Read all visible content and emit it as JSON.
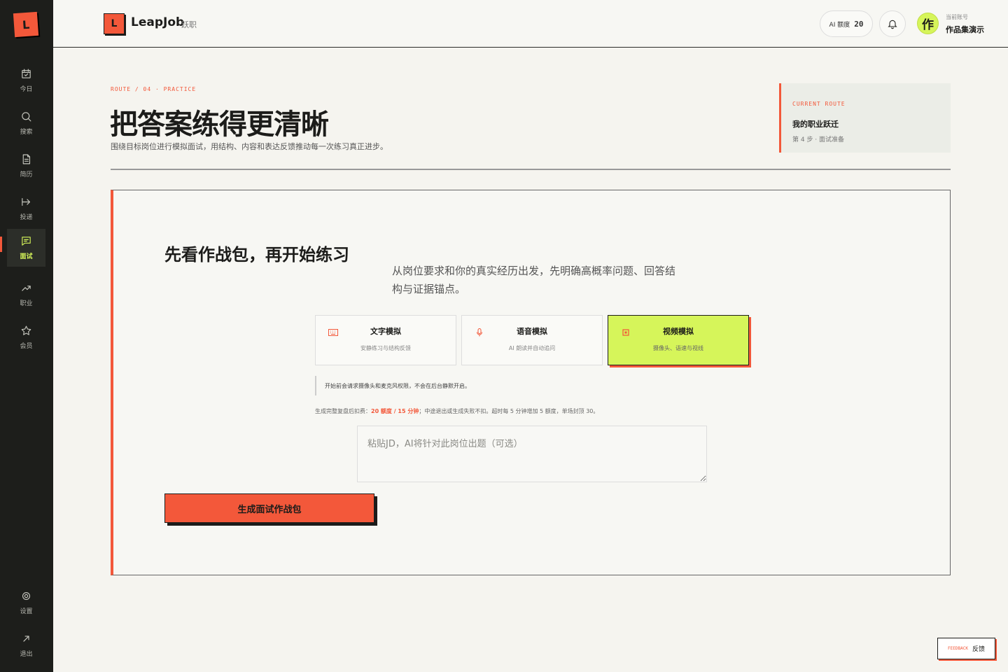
{
  "sidebar": {
    "logo": "L",
    "items": [
      {
        "label": "今日",
        "icon": "calendar-check-icon"
      },
      {
        "label": "搜索",
        "icon": "search-icon"
      },
      {
        "label": "简历",
        "icon": "document-icon"
      },
      {
        "label": "投递",
        "icon": "send-arrow-icon"
      },
      {
        "label": "面试",
        "icon": "chat-bubble-icon",
        "active": true
      },
      {
        "label": "职业",
        "icon": "trend-up-icon"
      },
      {
        "label": "会员",
        "icon": "star-icon"
      }
    ],
    "bottom": [
      {
        "label": "设置",
        "icon": "gear-icon"
      },
      {
        "label": "退出",
        "icon": "arrow-out-icon"
      }
    ]
  },
  "topbar": {
    "logo": "L",
    "brand": "LeapJob",
    "brand_cn": "跃职",
    "quota_label": "AI 额度",
    "quota_value": "20",
    "avatar": "作",
    "account_label": "当前账号",
    "account_name": "作品集演示"
  },
  "hero": {
    "route": "ROUTE / 04 · PRACTICE",
    "title": "把答案练得更清晰",
    "subtitle": "围绕目标岗位进行模拟面试，用结构、内容和表达反馈推动每一次练习真正进步。",
    "route_card": {
      "label": "CURRENT ROUTE",
      "name": "我的职业跃迁",
      "step": "第 4 步 · 面试准备"
    }
  },
  "card": {
    "title": "先看作战包，再开始练习",
    "description": "从岗位要求和你的真实经历出发，先明确高概率问题、回答结构与证据锚点。",
    "modes": [
      {
        "title": "文字模拟",
        "desc": "安静练习与结构反馈",
        "icon": "keyboard-icon"
      },
      {
        "title": "语音模拟",
        "desc": "AI 朗读并自动追问",
        "icon": "microphone-icon"
      },
      {
        "title": "视频模拟",
        "desc": "摄像头、语速与视线",
        "icon": "camera-icon",
        "selected": true
      }
    ],
    "notice": "开始前会请求摄像头和麦克风权限，不会在后台静默开启。",
    "cost_prefix": "生成完整复盘后扣费：",
    "cost_highlight": "20 额度 / 15 分钟",
    "cost_suffix": "；中途退出或生成失败不扣。超时每 5 分钟增加 5 额度，单场封顶 30。",
    "jd_placeholder": "粘贴JD，AI将针对此岗位出题（可选）",
    "jd_value": "",
    "generate_button": "生成面试作战包"
  },
  "feedback": {
    "en": "FEEDBACK",
    "cn": "反馈"
  },
  "colors": {
    "accent": "#f3583a",
    "lime": "#d6f55a",
    "sidebar": "#1d1e1b",
    "background": "#f5f4ef"
  }
}
